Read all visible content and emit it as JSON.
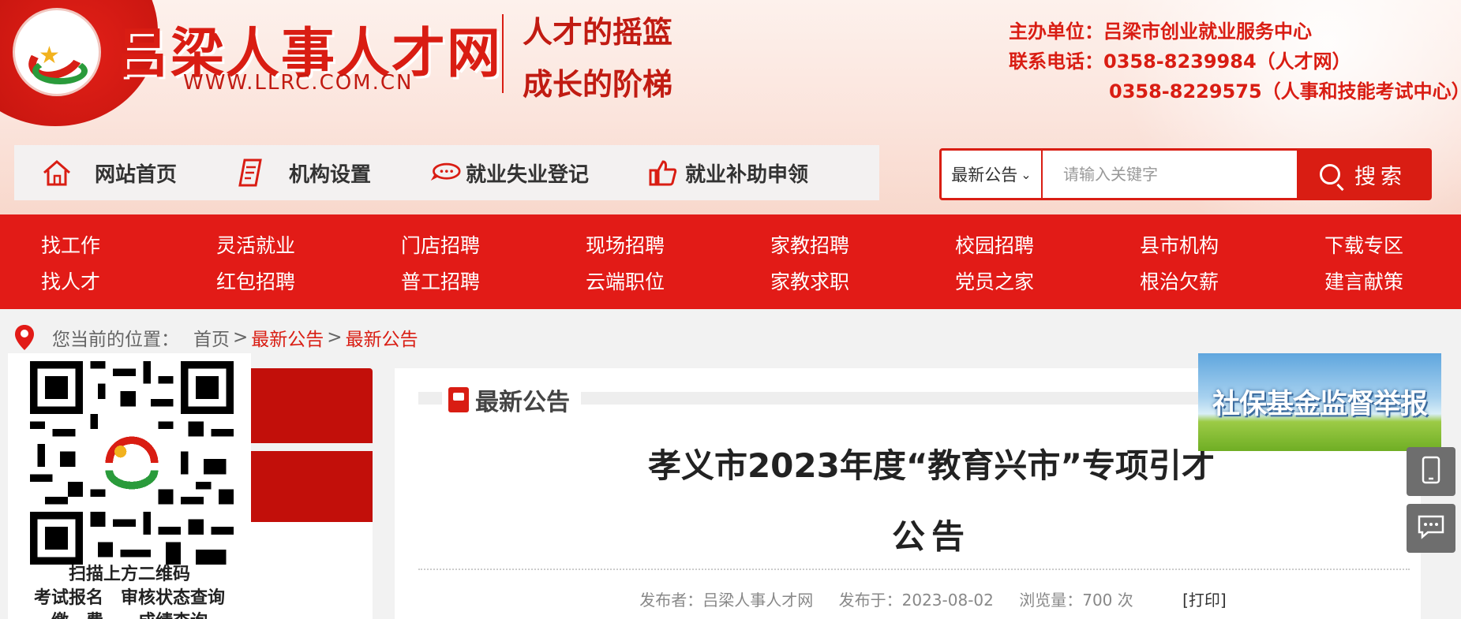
{
  "header": {
    "site_name": "吕梁人事人才网",
    "site_url": "WWW.LLRC.COM.CN",
    "slogan_1": "人才的摇篮",
    "slogan_2": "成长的阶梯",
    "sponsor": "主办单位：吕梁市创业就业服务中心",
    "phone_1": "联系电话：0358-8239984（人才网）",
    "phone_2": "0358-8229575（人事和技能考试中心）"
  },
  "quick_nav": [
    {
      "label": "网站首页",
      "icon": "home-icon"
    },
    {
      "label": "机构设置",
      "icon": "document-icon"
    },
    {
      "label": "就业失业登记",
      "icon": "chat-bubble-icon"
    },
    {
      "label": "就业补助申领",
      "icon": "thumbs-up-icon"
    }
  ],
  "search": {
    "category": "最新公告",
    "placeholder": "请输入关键字",
    "button": "搜索"
  },
  "main_nav": {
    "row1": [
      "找工作",
      "灵活就业",
      "门店招聘",
      "现场招聘",
      "家教招聘",
      "校园招聘",
      "县市机构",
      "下载专区"
    ],
    "row2": [
      "找人才",
      "红包招聘",
      "普工招聘",
      "云端职位",
      "家教求职",
      "党员之家",
      "根治欠薪",
      "建言献策"
    ]
  },
  "breadcrumb": {
    "prefix": "您当前的位置：",
    "home": "首页",
    "sep": ">",
    "level1": "最新公告",
    "level2": "最新公告"
  },
  "qr": {
    "caption_1": "扫描上方二维码",
    "caption_2": "考试报名　审核状态查询",
    "caption_3": "缴　费　　成绩查询"
  },
  "article": {
    "section_title": "最新公告",
    "title_line1": "孝义市2023年度“教育兴市”专项引才",
    "title_line2": "公告",
    "publisher": "发布者：吕梁人事人才网",
    "published": "发布于：2023-08-02",
    "views": "浏览量：700 次",
    "print": "[打印]"
  },
  "sidebar": {
    "banner_text": "社保基金监督举报"
  },
  "colors": {
    "brand_red": "#d91d13",
    "nav_red": "#e21b17",
    "float_gray": "#6e6e6e"
  }
}
